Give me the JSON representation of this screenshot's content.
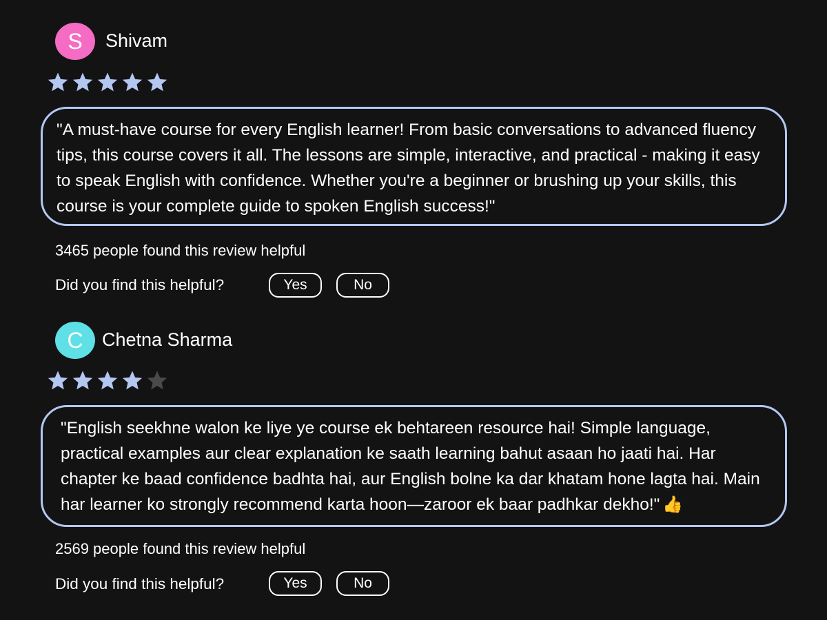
{
  "colors": {
    "background": "#131314",
    "star_filled": "#b4c7f1",
    "star_empty": "#4a4a4a",
    "review_border": "#b4c7f1"
  },
  "reviews": [
    {
      "avatar_initial": "S",
      "avatar_color": "#f56cc4",
      "name": "Shivam",
      "rating": 5,
      "max_rating": 5,
      "text": "\"A must-have course for every English learner! From basic conversations to advanced fluency tips, this course covers it all. The lessons are simple, interactive, and practical - making it easy to speak English with confidence. Whether you're a beginner or brushing up your skills, this course is your complete guide to spoken English success!\"",
      "helpful_count_text": "3465 people found this review helpful",
      "helpful_prompt": "Did you find this helpful?",
      "yes_label": "Yes",
      "no_label": "No"
    },
    {
      "avatar_initial": "C",
      "avatar_color": "#5ee0e6",
      "name": "Chetna Sharma",
      "rating": 4,
      "max_rating": 5,
      "text": "\"English seekhne walon ke liye ye course ek behtareen resource hai! Simple language, practical examples aur clear explanation ke saath learning bahut asaan ho jaati hai. Har chapter ke baad confidence badhta hai, aur English bolne ka dar khatam hone lagta hai. Main har learner ko strongly recommend karta hoon—zaroor ek baar padhkar dekho!\"",
      "trailing_icon": "thumbs-up-icon",
      "trailing_emoji": "👍",
      "helpful_count_text": "2569 people found this review helpful",
      "helpful_prompt": "Did you find this helpful?",
      "yes_label": "Yes",
      "no_label": "No"
    }
  ]
}
